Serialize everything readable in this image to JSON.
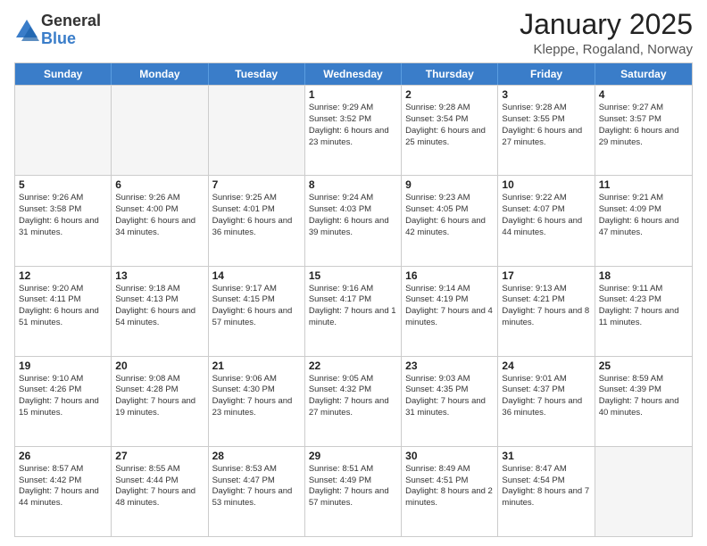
{
  "logo": {
    "general": "General",
    "blue": "Blue"
  },
  "header": {
    "month": "January 2025",
    "location": "Kleppe, Rogaland, Norway"
  },
  "weekdays": [
    "Sunday",
    "Monday",
    "Tuesday",
    "Wednesday",
    "Thursday",
    "Friday",
    "Saturday"
  ],
  "rows": [
    [
      {
        "day": "",
        "text": ""
      },
      {
        "day": "",
        "text": ""
      },
      {
        "day": "",
        "text": ""
      },
      {
        "day": "1",
        "text": "Sunrise: 9:29 AM\nSunset: 3:52 PM\nDaylight: 6 hours and 23 minutes."
      },
      {
        "day": "2",
        "text": "Sunrise: 9:28 AM\nSunset: 3:54 PM\nDaylight: 6 hours and 25 minutes."
      },
      {
        "day": "3",
        "text": "Sunrise: 9:28 AM\nSunset: 3:55 PM\nDaylight: 6 hours and 27 minutes."
      },
      {
        "day": "4",
        "text": "Sunrise: 9:27 AM\nSunset: 3:57 PM\nDaylight: 6 hours and 29 minutes."
      }
    ],
    [
      {
        "day": "5",
        "text": "Sunrise: 9:26 AM\nSunset: 3:58 PM\nDaylight: 6 hours and 31 minutes."
      },
      {
        "day": "6",
        "text": "Sunrise: 9:26 AM\nSunset: 4:00 PM\nDaylight: 6 hours and 34 minutes."
      },
      {
        "day": "7",
        "text": "Sunrise: 9:25 AM\nSunset: 4:01 PM\nDaylight: 6 hours and 36 minutes."
      },
      {
        "day": "8",
        "text": "Sunrise: 9:24 AM\nSunset: 4:03 PM\nDaylight: 6 hours and 39 minutes."
      },
      {
        "day": "9",
        "text": "Sunrise: 9:23 AM\nSunset: 4:05 PM\nDaylight: 6 hours and 42 minutes."
      },
      {
        "day": "10",
        "text": "Sunrise: 9:22 AM\nSunset: 4:07 PM\nDaylight: 6 hours and 44 minutes."
      },
      {
        "day": "11",
        "text": "Sunrise: 9:21 AM\nSunset: 4:09 PM\nDaylight: 6 hours and 47 minutes."
      }
    ],
    [
      {
        "day": "12",
        "text": "Sunrise: 9:20 AM\nSunset: 4:11 PM\nDaylight: 6 hours and 51 minutes."
      },
      {
        "day": "13",
        "text": "Sunrise: 9:18 AM\nSunset: 4:13 PM\nDaylight: 6 hours and 54 minutes."
      },
      {
        "day": "14",
        "text": "Sunrise: 9:17 AM\nSunset: 4:15 PM\nDaylight: 6 hours and 57 minutes."
      },
      {
        "day": "15",
        "text": "Sunrise: 9:16 AM\nSunset: 4:17 PM\nDaylight: 7 hours and 1 minute."
      },
      {
        "day": "16",
        "text": "Sunrise: 9:14 AM\nSunset: 4:19 PM\nDaylight: 7 hours and 4 minutes."
      },
      {
        "day": "17",
        "text": "Sunrise: 9:13 AM\nSunset: 4:21 PM\nDaylight: 7 hours and 8 minutes."
      },
      {
        "day": "18",
        "text": "Sunrise: 9:11 AM\nSunset: 4:23 PM\nDaylight: 7 hours and 11 minutes."
      }
    ],
    [
      {
        "day": "19",
        "text": "Sunrise: 9:10 AM\nSunset: 4:26 PM\nDaylight: 7 hours and 15 minutes."
      },
      {
        "day": "20",
        "text": "Sunrise: 9:08 AM\nSunset: 4:28 PM\nDaylight: 7 hours and 19 minutes."
      },
      {
        "day": "21",
        "text": "Sunrise: 9:06 AM\nSunset: 4:30 PM\nDaylight: 7 hours and 23 minutes."
      },
      {
        "day": "22",
        "text": "Sunrise: 9:05 AM\nSunset: 4:32 PM\nDaylight: 7 hours and 27 minutes."
      },
      {
        "day": "23",
        "text": "Sunrise: 9:03 AM\nSunset: 4:35 PM\nDaylight: 7 hours and 31 minutes."
      },
      {
        "day": "24",
        "text": "Sunrise: 9:01 AM\nSunset: 4:37 PM\nDaylight: 7 hours and 36 minutes."
      },
      {
        "day": "25",
        "text": "Sunrise: 8:59 AM\nSunset: 4:39 PM\nDaylight: 7 hours and 40 minutes."
      }
    ],
    [
      {
        "day": "26",
        "text": "Sunrise: 8:57 AM\nSunset: 4:42 PM\nDaylight: 7 hours and 44 minutes."
      },
      {
        "day": "27",
        "text": "Sunrise: 8:55 AM\nSunset: 4:44 PM\nDaylight: 7 hours and 48 minutes."
      },
      {
        "day": "28",
        "text": "Sunrise: 8:53 AM\nSunset: 4:47 PM\nDaylight: 7 hours and 53 minutes."
      },
      {
        "day": "29",
        "text": "Sunrise: 8:51 AM\nSunset: 4:49 PM\nDaylight: 7 hours and 57 minutes."
      },
      {
        "day": "30",
        "text": "Sunrise: 8:49 AM\nSunset: 4:51 PM\nDaylight: 8 hours and 2 minutes."
      },
      {
        "day": "31",
        "text": "Sunrise: 8:47 AM\nSunset: 4:54 PM\nDaylight: 8 hours and 7 minutes."
      },
      {
        "day": "",
        "text": ""
      }
    ]
  ]
}
